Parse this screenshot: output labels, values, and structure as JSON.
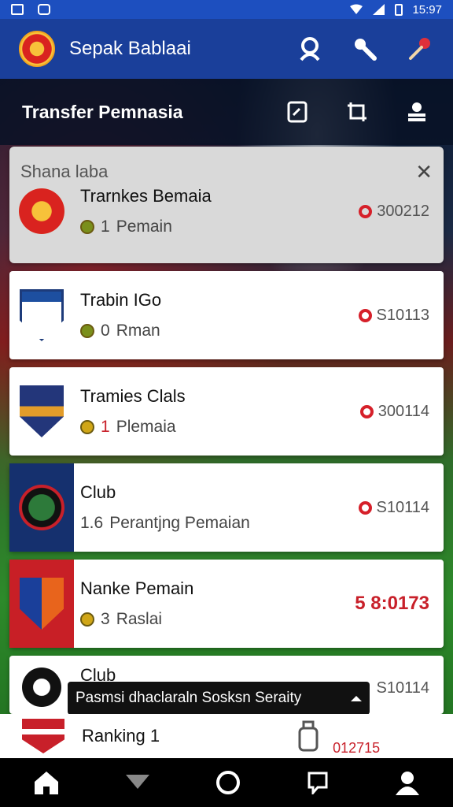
{
  "status_bar": {
    "time": "15:97"
  },
  "app_bar": {
    "title": "Sepak Bablaai"
  },
  "sub_header": {
    "title": "Transfer Pemnasia"
  },
  "shana_card": {
    "title": "Shana laba",
    "item": {
      "name": "Trarnkes Bemaia",
      "count": "1",
      "label": "Pemain",
      "value": "300212"
    }
  },
  "cards": [
    {
      "name": "Trabin IGo",
      "count": "0",
      "label": "Rman",
      "value": "S10113"
    },
    {
      "name": "Tramies Clals",
      "count": "1",
      "label": "Plemaia",
      "value": "300114"
    },
    {
      "name": "Club",
      "count": "1.6",
      "label": "Perantjng Pemaian",
      "value": "S10114"
    },
    {
      "name": "Nanke Pemain",
      "count": "3",
      "label": "Raslai",
      "value": "5 8:0173"
    },
    {
      "name": "Club",
      "count": "",
      "label": "",
      "value": "S10114"
    }
  ],
  "toast": {
    "text": "Pasmsi dhaclaraln Sosksn Seraity"
  },
  "bottom_card": {
    "name": "Ranking 1",
    "value": "012715"
  },
  "colors": {
    "primary": "#1a3f9a",
    "status": "#1d4fbf",
    "accent_red": "#d6202a"
  },
  "icons": [
    "profile-icon",
    "wrench-icon",
    "pin-icon",
    "edit-icon",
    "crop-icon",
    "stack-icon",
    "home-icon",
    "down-icon",
    "circle-icon",
    "chat-icon",
    "user-icon"
  ]
}
